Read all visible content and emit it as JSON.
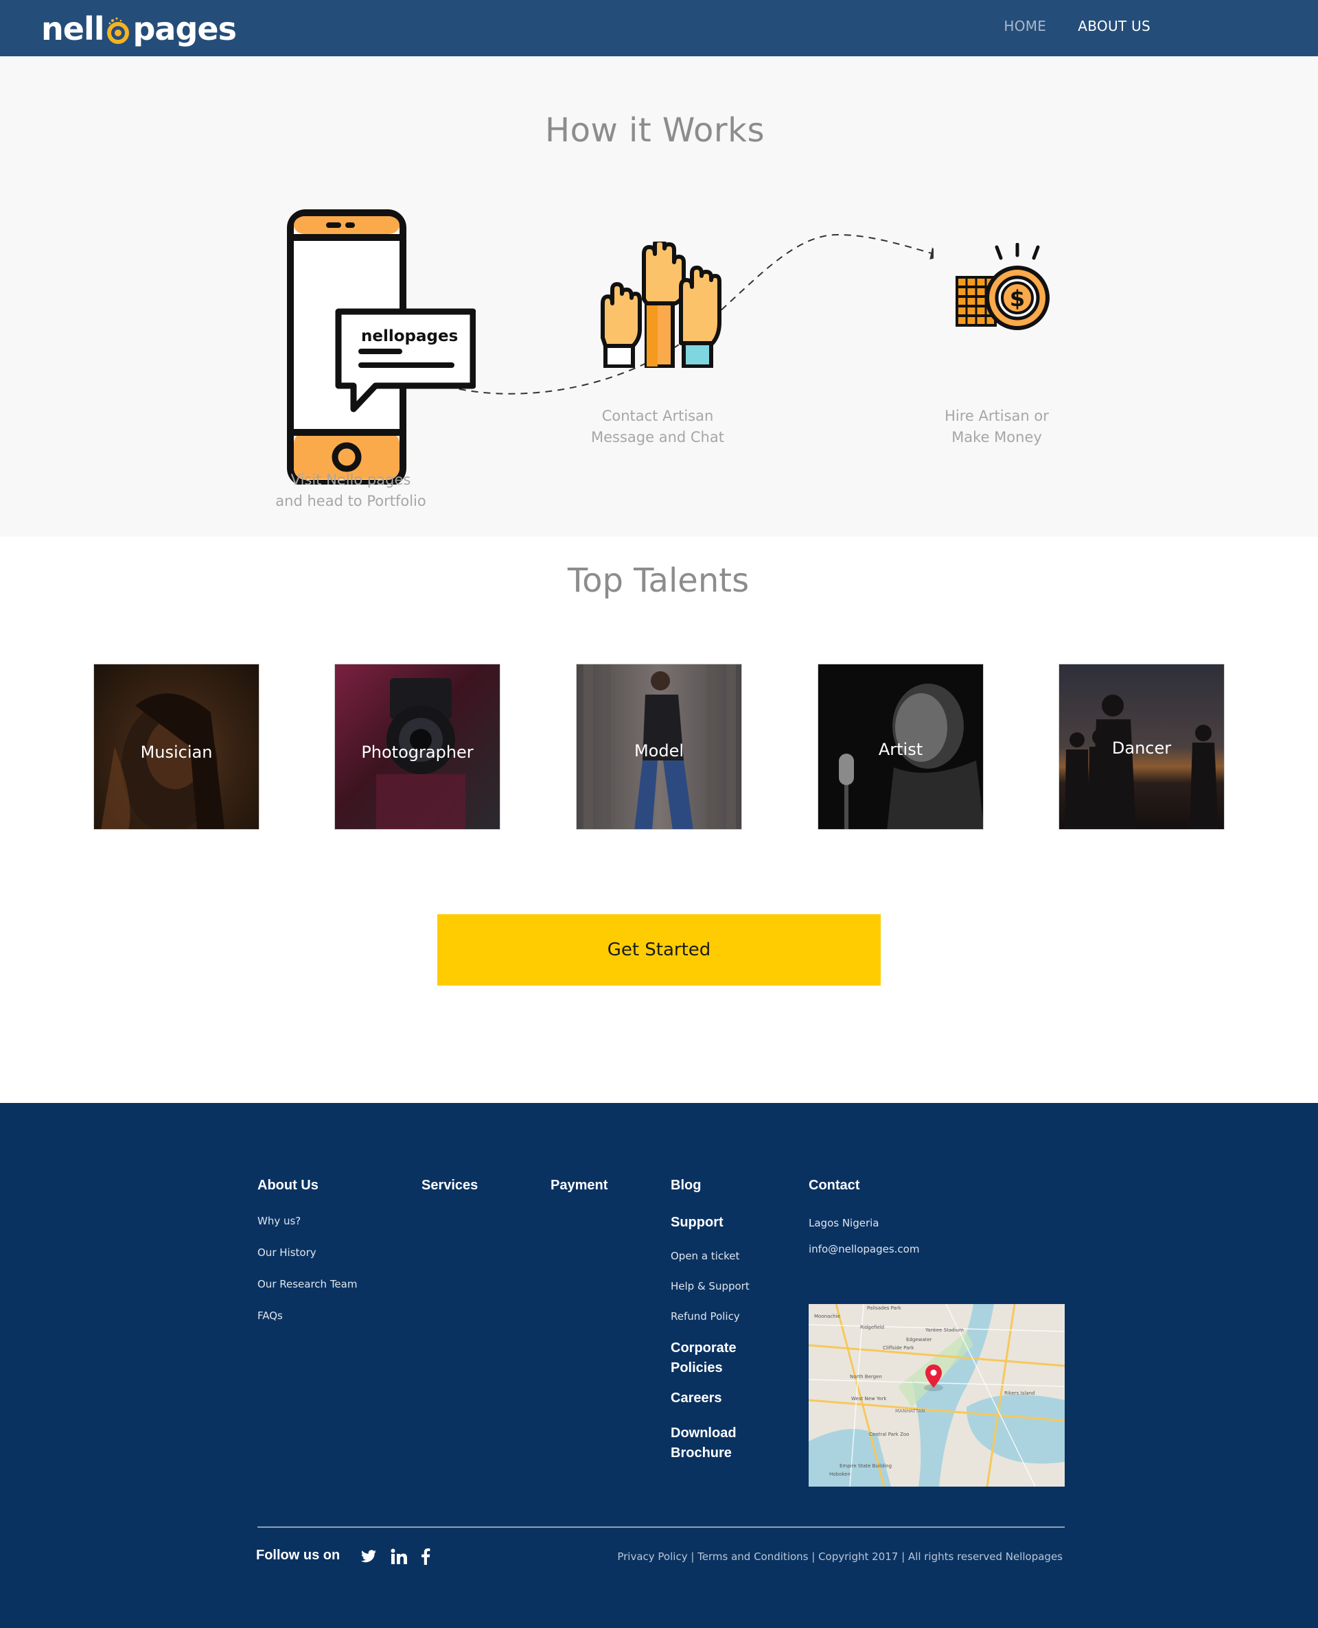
{
  "header": {
    "logo_left": "nell",
    "logo_right": "pages",
    "nav": [
      {
        "label": "HOME"
      },
      {
        "label": "ABOUT US"
      }
    ]
  },
  "how_it_works": {
    "title": "How it Works",
    "phone_bubble": "nellopages",
    "steps": [
      {
        "line1": "Visit Nello pages",
        "line2": "and head to Portfolio"
      },
      {
        "line1": "Contact Artisan",
        "line2": "Message and Chat"
      },
      {
        "line1": "Hire Artisan or",
        "line2": "Make Money"
      }
    ]
  },
  "talents": {
    "title": "Top Talents",
    "items": [
      {
        "label": "Musician"
      },
      {
        "label": "Photographer"
      },
      {
        "label": "Model"
      },
      {
        "label": "Artist"
      },
      {
        "label": "Dancer"
      }
    ]
  },
  "cta": {
    "label": "Get Started"
  },
  "footer": {
    "about": {
      "heading": "About Us",
      "links": [
        "Why us?",
        "Our History",
        "Our Research Team",
        "FAQs"
      ]
    },
    "services": {
      "heading": "Services"
    },
    "payment": {
      "heading": "Payment"
    },
    "blog": {
      "heading": "Blog"
    },
    "support": {
      "heading": "Support",
      "links": [
        "Open a ticket",
        "Help & Support",
        "Refund Policy"
      ]
    },
    "corporate": {
      "line1": "Corporate",
      "line2": "Policies"
    },
    "careers": {
      "heading": "Careers"
    },
    "download": {
      "line1": "Download",
      "line2": "Brochure"
    },
    "contact": {
      "heading": "Contact",
      "address": "Lagos Nigeria",
      "email": "info@nellopages.com"
    },
    "map_labels": [
      "Palisades Park",
      "Ridgefield",
      "Yankee Stadium",
      "Edgewater",
      "Cliffside Park",
      "North Bergen",
      "West New York",
      "MANHATTAN",
      "Central Park Zoo",
      "Rikers Island",
      "Empire State Building",
      "Hoboken",
      "Moonachie"
    ],
    "follow": "Follow us on",
    "legal": "Privacy Policy | Terms and Conditions | Copyright 2017 | All rights reserved Nellopages"
  },
  "colors": {
    "header_bg": "#254d79",
    "footer_bg": "#0a3261",
    "accent_yellow": "#ffcc02",
    "icon_orange": "#fbaa4b"
  }
}
